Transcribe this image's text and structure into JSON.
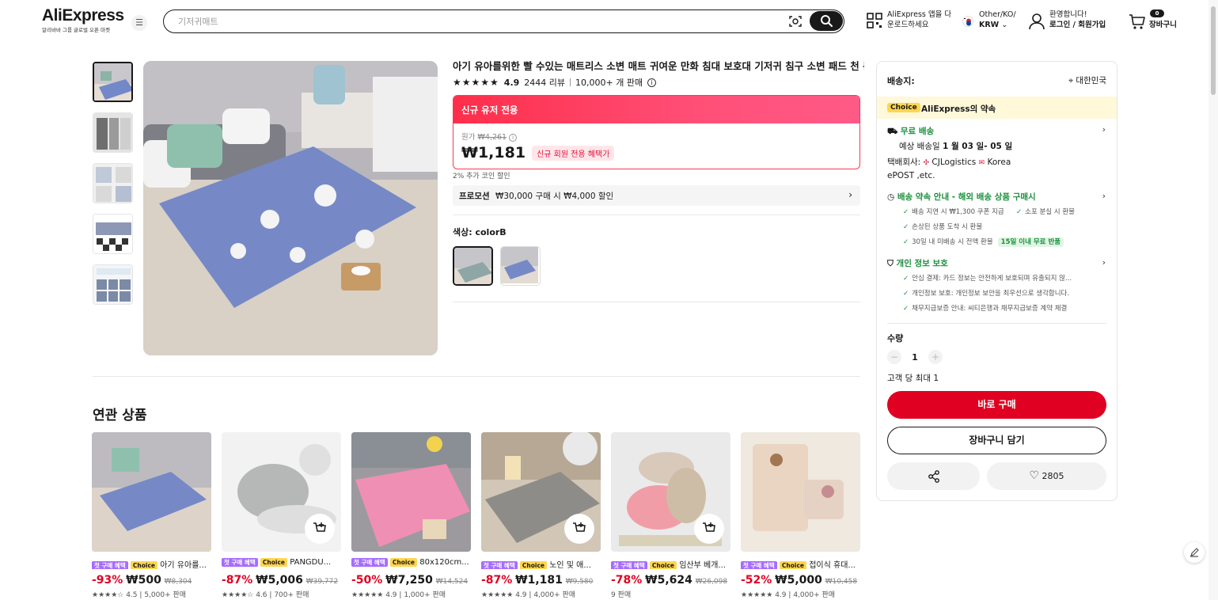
{
  "header": {
    "logo": "AliExpress",
    "logo_sub": "알리바바 그룹 글로벌 오픈 마켓",
    "search_placeholder": "기저귀매트",
    "app_line1": "AliExpress 앱을 다",
    "app_line2": "운로드하세요",
    "lang_line1": "Other/KO/",
    "lang_line2": "KRW",
    "user_line1": "환영합니다!",
    "user_line2": "로그인 / 회원가입",
    "cart_count": "0",
    "cart_label": "장바구니"
  },
  "product": {
    "title": "아기 유아를위한 빨 수있는 매트리스 소변 매트 귀여운 만화 침대 보호대 기저귀 침구 소변 패드 천 통기성",
    "rating": "4.9",
    "reviews": "2444 리뷰",
    "sold": "10,000+ 개 판매",
    "new_user_header": "신규 유저 전용",
    "orig_label": "원가",
    "orig_price": "₩4,261",
    "price": "₩1,181",
    "new_user_badge": "신규 회원 전용 혜택가",
    "coin_text": "2% 추가 코인 할인",
    "promo_label": "프로모션",
    "promo_text": "₩30,000 구매 시 ₩4,000 할인",
    "color_label": "색상: colorB"
  },
  "panel": {
    "ship_to_label": "배송지:",
    "ship_to_value": "대한민국",
    "choice_tag": "Choice",
    "choice_text": "AliExpress의 약속",
    "free_ship": "무료 배송",
    "eta_prefix": "예상 배송일",
    "eta_value": "1 월 03 일- 05 일",
    "carrier_prefix": "택배회사:",
    "carrier_value": "CJLogistics",
    "carrier_value2": "Korea",
    "carrier_value3": "ePOST ,etc.",
    "delivery_title": "배송 약속 안내 - 해외 배송 상품 구매시",
    "d1": "배송 지연 시 ₩1,300 쿠폰 지급",
    "d2": "소포 분실 시 환불",
    "d3": "손상된 상품 도착 시 환불",
    "d4": "30일 내 미배송 시 전액 환불",
    "d4_tag": "15일 이내 무료 반품",
    "privacy_title": "개인 정보 보호",
    "p1": "안심 결제: 카드 정보는 안전하게 보호되며 유출되지 않...",
    "p2": "개인정보 보호: 개인정보 보안을 최우선으로 생각합니다.",
    "p3": "채무지급보증 안내: 씨티은행과 채무지급보증 계약 체결",
    "qty_label": "수량",
    "qty_value": "1",
    "max_text": "고객 당 최대 1",
    "buy_label": "바로 구매",
    "cart_label": "장바구니 담기",
    "wish_count": "2805"
  },
  "related": {
    "title": "연관 상품",
    "tag_first": "첫 구매 혜택",
    "tag_choice": "Choice",
    "items": [
      {
        "name": "아기 유아를...",
        "disc": "-93%",
        "price": "₩500",
        "was": "₩8,304",
        "rating": "4.5",
        "sold": "5,000+ 판매"
      },
      {
        "name": "PANGDU...",
        "disc": "-87%",
        "price": "₩5,006",
        "was": "₩39,772",
        "rating": "4.6",
        "sold": "700+ 판매"
      },
      {
        "name": "80x120cm...",
        "disc": "-50%",
        "price": "₩7,250",
        "was": "₩14,524",
        "rating": "4.9",
        "sold": "1,000+ 판매"
      },
      {
        "name": "노인 및 애...",
        "disc": "-87%",
        "price": "₩1,181",
        "was": "₩9,580",
        "rating": "4.9",
        "sold": "4,000+ 판매"
      },
      {
        "name": "임산부 베개...",
        "disc": "-78%",
        "price": "₩5,624",
        "was": "₩26,098",
        "rating": "",
        "sold": "9 판매"
      },
      {
        "name": "접이식 휴대...",
        "disc": "-52%",
        "price": "₩5,000",
        "was": "₩10,458",
        "rating": "4.9",
        "sold": "4,000+ 판매"
      }
    ]
  },
  "colors": {
    "accent_red": "#e00022",
    "choice_yellow": "#ffd64f",
    "first_purchase_purple": "#a66cff",
    "green": "#1a8f3c"
  }
}
